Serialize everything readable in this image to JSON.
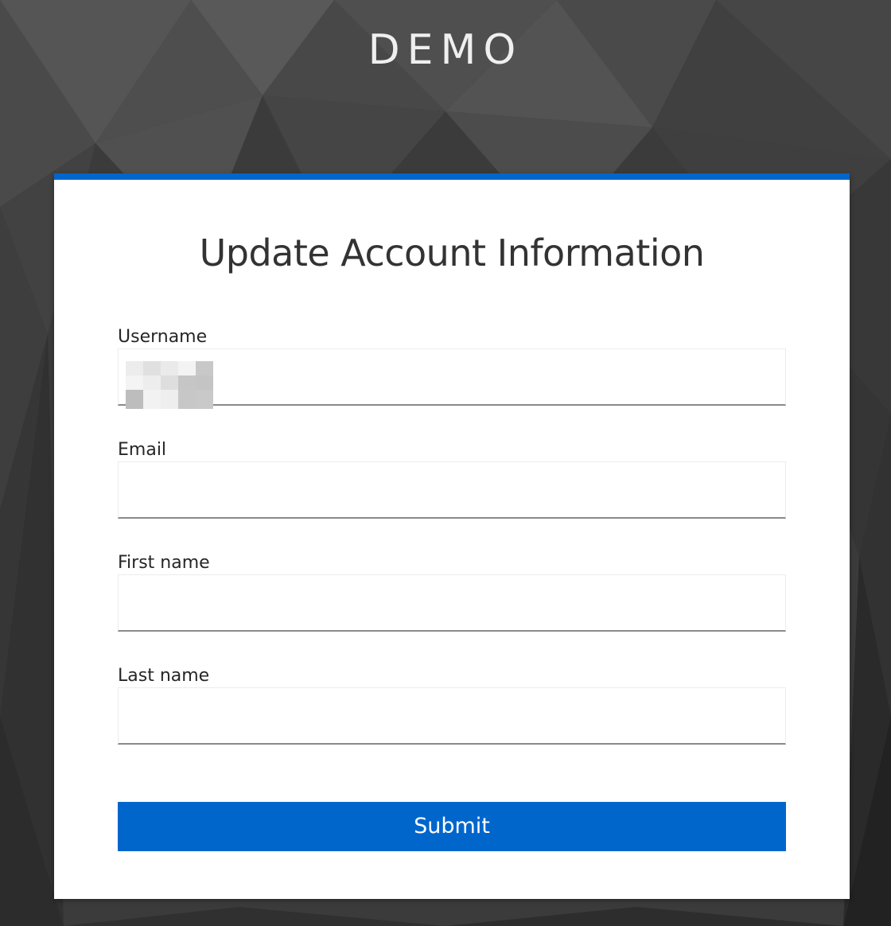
{
  "brand": {
    "title": "DEMO"
  },
  "form": {
    "title": "Update Account Information",
    "fields": [
      {
        "label": "Username",
        "value": "",
        "redacted": true
      },
      {
        "label": "Email",
        "value": ""
      },
      {
        "label": "First name",
        "value": ""
      },
      {
        "label": "Last name",
        "value": ""
      }
    ],
    "submit_label": "Submit"
  },
  "colors": {
    "accent": "#0066cc",
    "background": "#3a3a3a",
    "card": "#ffffff",
    "text": "#333333"
  }
}
